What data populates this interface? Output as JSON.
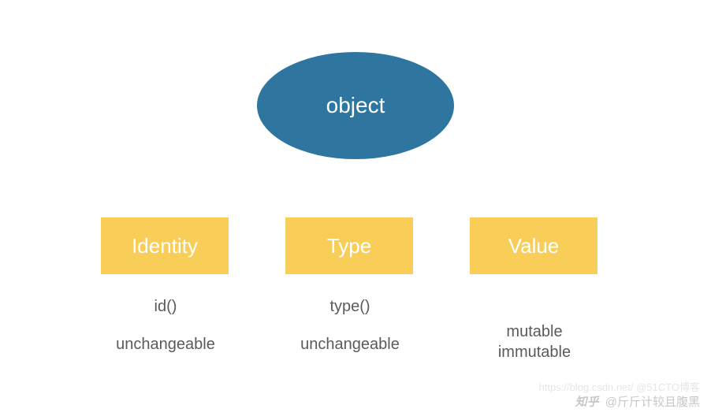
{
  "root": {
    "label": "object",
    "color": "#2e76a0"
  },
  "branches": [
    {
      "title": "Identity",
      "fn": "id()",
      "desc": [
        "unchangeable"
      ]
    },
    {
      "title": "Type",
      "fn": "type()",
      "desc": [
        "unchangeable"
      ]
    },
    {
      "title": "Value",
      "fn": "",
      "desc": [
        "mutable",
        "immutable"
      ]
    }
  ],
  "box_color": "#f8ce58",
  "watermarks": {
    "primary_prefix": "知乎",
    "primary": "@斤斤计较且腹黑",
    "secondary": "https://blog.csdn.net/  @51CTO博客"
  }
}
